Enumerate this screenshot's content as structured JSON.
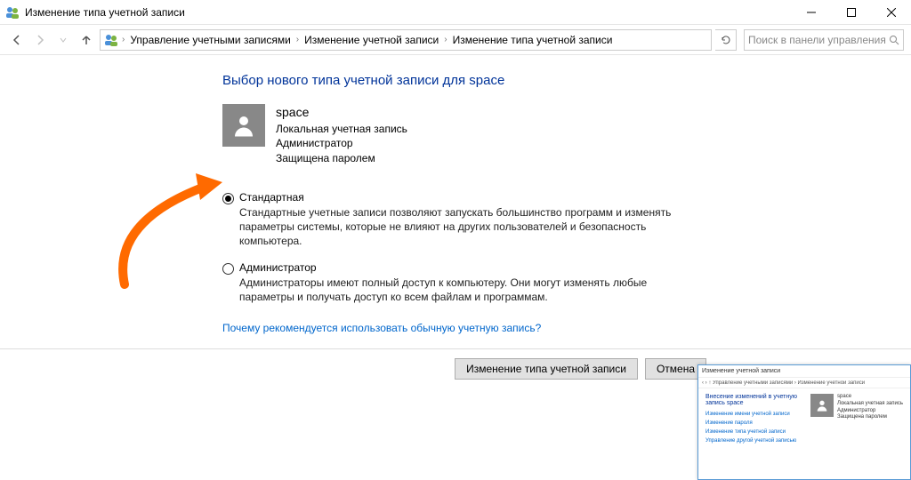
{
  "titlebar": {
    "title": "Изменение типа учетной записи"
  },
  "nav": {
    "crumbs": [
      "Управление учетными записями",
      "Изменение учетной записи",
      "Изменение типа учетной записи"
    ],
    "search_placeholder": "Поиск в панели управления"
  },
  "heading": "Выбор нового типа учетной записи для space",
  "user": {
    "name": "space",
    "line1": "Локальная учетная запись",
    "line2": "Администратор",
    "line3": "Защищена паролем"
  },
  "options": {
    "standard": {
      "label": "Стандартная",
      "desc": "Стандартные учетные записи позволяют запускать большинство программ и изменять параметры системы, которые не влияют на других пользователей и безопасность компьютера."
    },
    "admin": {
      "label": "Администратор",
      "desc": "Администраторы имеют полный доступ к компьютеру. Они могут изменять любые параметры и получать доступ ко всем файлам и программам."
    }
  },
  "help_link": "Почему рекомендуется использовать обычную учетную запись?",
  "buttons": {
    "apply": "Изменение типа учетной записи",
    "cancel": "Отмена"
  },
  "thumb": {
    "title": "Изменение учетной записи",
    "crumb": "‹ › ↑  Управление учетными записями › Изменение учетной записи",
    "heading": "Внесение изменений в учетную запись space",
    "links": [
      "Изменение имени учетной записи",
      "Изменение пароля",
      "Изменение типа учетной записи",
      "Управление другой учетной записью"
    ],
    "user": {
      "name": "space",
      "l1": "Локальная учетная запись",
      "l2": "Администратор",
      "l3": "Защищена паролем"
    }
  }
}
